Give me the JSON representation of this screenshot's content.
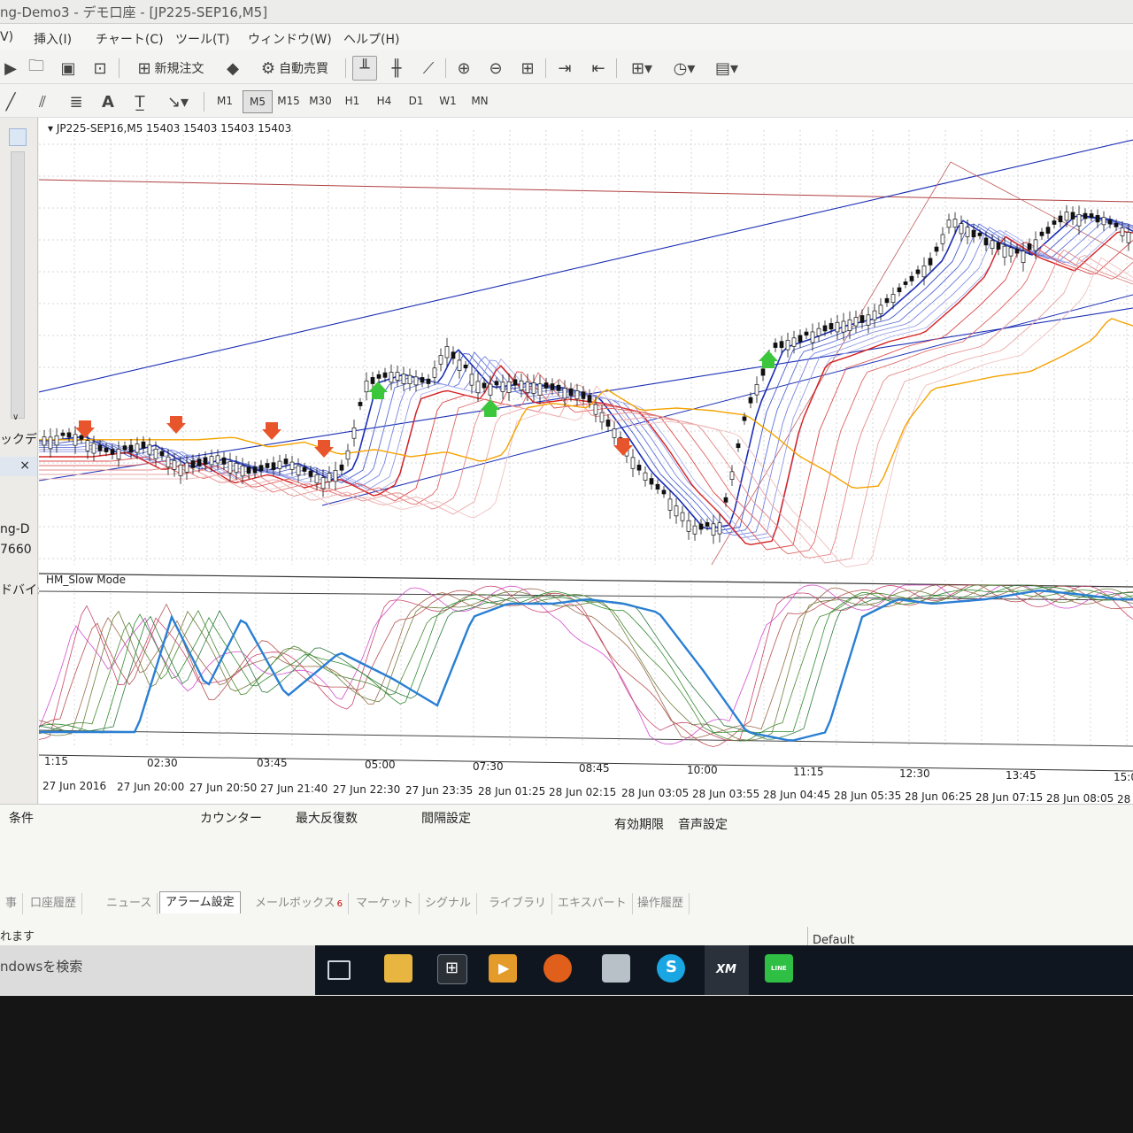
{
  "window": {
    "title": "ng-Demo3 - デモ口座 - [JP225-SEP16,M5]"
  },
  "menu": [
    "V)",
    "挿入(I)",
    "チャート(C)",
    "ツール(T)",
    "ウィンドウ(W)",
    "ヘルプ(H)"
  ],
  "toolbar": {
    "new_order": "新規注文",
    "auto_trade": "自動売買"
  },
  "timeframes": [
    "M1",
    "M5",
    "M15",
    "M30",
    "H1",
    "H4",
    "D1",
    "W1",
    "MN"
  ],
  "active_timeframe": "M5",
  "left_panel": {
    "label1": "ックデ",
    "label2": "ng-D",
    "label3": "7660",
    "label4": "ドバイ:"
  },
  "chart": {
    "header": "JP225-SEP16,M5  15403 15403 15403 15403",
    "indicator_name": "HM_Slow Mode",
    "top_time_labels": [
      "1:15",
      "02:30",
      "03:45",
      "05:00",
      "07:30",
      "08:45",
      "10:00",
      "11:15",
      "12:30",
      "13:45",
      "15:0"
    ],
    "date_labels": [
      "27 Jun 2016",
      "27 Jun 20:00",
      "27 Jun 20:50",
      "27 Jun 21:40",
      "27 Jun 22:30",
      "27 Jun 23:35",
      "28 Jun 01:25",
      "28 Jun 02:15",
      "28 Jun 03:05",
      "28 Jun 03:55",
      "28 Jun 04:45",
      "28 Jun 05:35",
      "28 Jun 06:25",
      "28 Jun 07:15",
      "28 Jun 08:05",
      "28"
    ],
    "colors": {
      "ma_red": "#d62020",
      "ma_blue": "#1b2fb5",
      "ma_orange": "#f5a300",
      "signal_up": "#3cc63c",
      "signal_down": "#e8552c",
      "osc_thick": "#2a7fd4",
      "osc_magenta": "#d24fd0",
      "osc_green": "#2e8b2e"
    }
  },
  "alarm_columns": [
    "条件",
    "カウンター",
    "最大反復数",
    "間隔設定",
    "有効期限",
    "音声設定"
  ],
  "tabs": [
    "事",
    "口座履歴",
    "ニュース",
    "アラーム設定",
    "メールボックス",
    "マーケット",
    "シグナル",
    "ライブラリ",
    "エキスパート",
    "操作履歴"
  ],
  "mail_badge": "6",
  "active_tab": "アラーム設定",
  "status": {
    "left": "れます",
    "right": "Default"
  },
  "taskbar": {
    "search": "ndowsを検索",
    "xm_label": "XM",
    "line_label": "LINE"
  }
}
